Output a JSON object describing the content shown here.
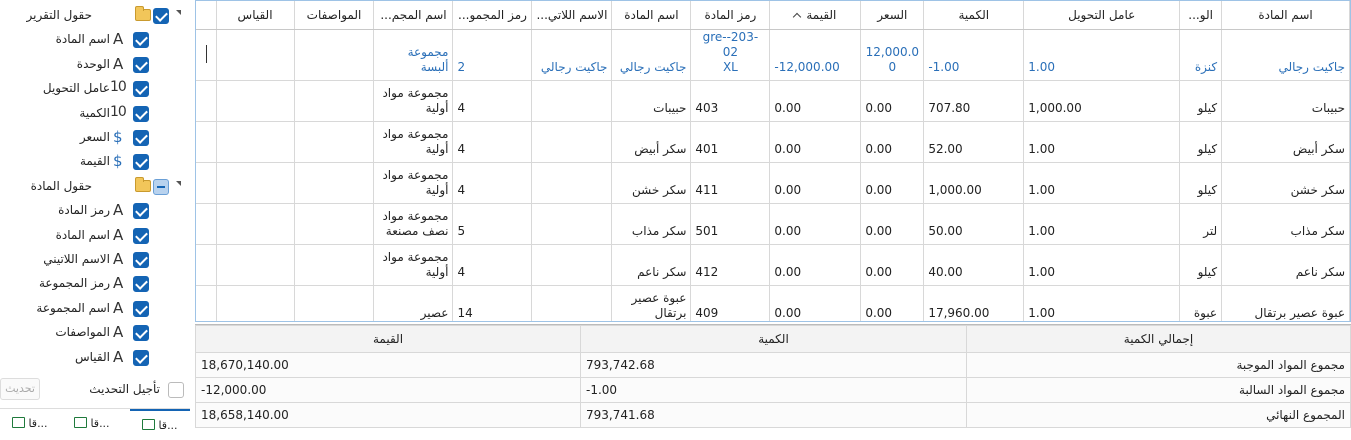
{
  "field_list": {
    "items": [
      {
        "label": "حقول التقرير",
        "kind": "folder",
        "state": "checked",
        "level": 0
      },
      {
        "label": "اسم المادة",
        "kind": "text",
        "state": "checked",
        "level": 1
      },
      {
        "label": "الوحدة",
        "kind": "text",
        "state": "checked",
        "level": 1
      },
      {
        "label": "عامل التحويل",
        "kind": "number",
        "state": "checked",
        "level": 1
      },
      {
        "label": "الكمية",
        "kind": "number",
        "state": "checked",
        "level": 1
      },
      {
        "label": "السعر",
        "kind": "currency",
        "state": "checked",
        "level": 1
      },
      {
        "label": "القيمة",
        "kind": "currency",
        "state": "checked",
        "level": 1
      },
      {
        "label": "حقول المادة",
        "kind": "folder",
        "state": "partial",
        "level": 0
      },
      {
        "label": "رمز المادة",
        "kind": "text",
        "state": "checked",
        "level": 1
      },
      {
        "label": "اسم المادة",
        "kind": "text",
        "state": "checked",
        "level": 1
      },
      {
        "label": "الاسم اللاتيني",
        "kind": "text",
        "state": "checked",
        "level": 1
      },
      {
        "label": "رمز المجموعة",
        "kind": "text",
        "state": "checked",
        "level": 1
      },
      {
        "label": "اسم المجموعة",
        "kind": "text",
        "state": "checked",
        "level": 1
      },
      {
        "label": "المواصفات",
        "kind": "text",
        "state": "checked",
        "level": 1
      },
      {
        "label": "القياس",
        "kind": "text",
        "state": "checked",
        "level": 1
      }
    ],
    "icon_text": "A",
    "icon_number": "10",
    "icon_currency": "$",
    "defer_label": "تأجيل التحديث",
    "update_label": "تحديث",
    "tabs": [
      "قا...",
      "قا...",
      "قا..."
    ]
  },
  "grid": {
    "columns": [
      "اسم المادة",
      "الو...",
      "عامل التحويل",
      "الكمية",
      "السعر",
      "القيمة",
      "رمز المادة",
      "اسم المادة",
      "الاسم اللاتي...",
      "رمز المجمو...",
      "اسم المجم...",
      "المواصفات",
      "القياس"
    ],
    "rows": [
      [
        "جاكيت رجالي",
        "كنزة",
        "1.00",
        "-1.00",
        "12,000.0\n0",
        "-12,000.00",
        "gre--203-02\nXL",
        "جاكيت رجالي",
        "جاكيت رجالي",
        "2",
        "مجموعة\nألبسة",
        "",
        ""
      ],
      [
        "حبيبات",
        "كيلو",
        "1,000.00",
        "707.80",
        "0.00",
        "0.00",
        "403",
        "حبيبات",
        "",
        "4",
        "مجموعة مواد\nأولية",
        "",
        ""
      ],
      [
        "سكر أبيض",
        "كيلو",
        "1.00",
        "52.00",
        "0.00",
        "0.00",
        "401",
        "سكر أبيض",
        "",
        "4",
        "مجموعة مواد\nأولية",
        "",
        ""
      ],
      [
        "سكر خشن",
        "كيلو",
        "1.00",
        "1,000.00",
        "0.00",
        "0.00",
        "411",
        "سكر خشن",
        "",
        "4",
        "مجموعة مواد\nأولية",
        "",
        ""
      ],
      [
        "سكر مذاب",
        "لتر",
        "1.00",
        "50.00",
        "0.00",
        "0.00",
        "501",
        "سكر مذاب",
        "",
        "5",
        "مجموعة مواد\nنصف مصنعة",
        "",
        ""
      ],
      [
        "سكر ناعم",
        "كيلو",
        "1.00",
        "40.00",
        "0.00",
        "0.00",
        "412",
        "سكر ناعم",
        "",
        "4",
        "مجموعة مواد\nأولية",
        "",
        ""
      ],
      [
        "عبوة عصير برتقال",
        "عبوة",
        "1.00",
        "17,960.00",
        "0.00",
        "0.00",
        "409",
        "عبوة عصير\nبرتقال",
        "",
        "14",
        "عصير",
        "",
        ""
      ]
    ]
  },
  "summary": {
    "headers": [
      "إجمالي الكمية",
      "الكمية",
      "القيمة"
    ],
    "rows": [
      [
        "مجموع المواد الموجبة",
        "793,742.68",
        "18,670,140.00"
      ],
      [
        "مجموع المواد السالبة",
        "-1.00",
        "-12,000.00"
      ],
      [
        "المجموع النهائي",
        "793,741.68",
        "18,658,140.00"
      ]
    ]
  },
  "colors": {
    "accent": "#1464b4",
    "link_text": "#2a6fb8",
    "grid_border": "#9ec3e6"
  }
}
